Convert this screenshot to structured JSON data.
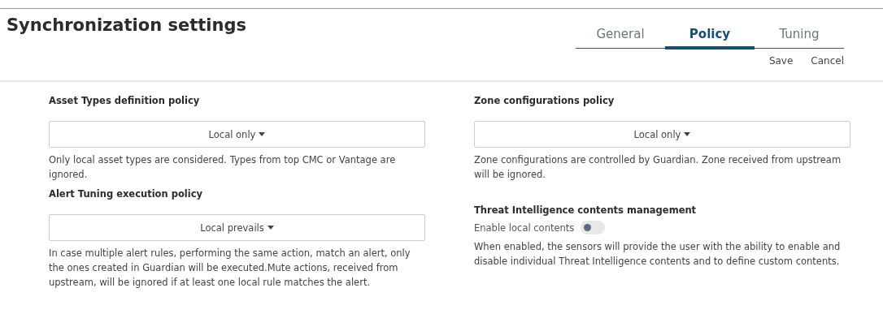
{
  "title": "Synchronization settings",
  "tabs": [
    {
      "label": "General",
      "selected": false
    },
    {
      "label": "Policy",
      "selected": true
    },
    {
      "label": "Tuning",
      "selected": false
    }
  ],
  "actions": [
    "Save",
    "Cancel"
  ],
  "columns": [
    {
      "sections": [
        {
          "kind": "select",
          "heading": "Asset Types definition policy",
          "value": "Local only",
          "description": "Only local asset types are considered. Types from top CMC or Vantage are ignored."
        },
        {
          "kind": "select",
          "heading": "Alert Tuning execution policy",
          "value": "Local prevails",
          "description": "In case multiple alert rules, performing the same action, match an alert, only the ones created in Guardian will be executed.Mute actions, received from upstream, will be ignored if at least one local rule matches the alert."
        }
      ]
    },
    {
      "sections": [
        {
          "kind": "select",
          "heading": "Zone configurations policy",
          "value": "Local only",
          "description": "Zone configurations are controlled by Guardian. Zone received from upstream will be ignored."
        },
        {
          "kind": "toggle",
          "heading": "Threat Intelligence contents management",
          "label": "Enable local contents",
          "on": false,
          "description": "When enabled, the sensors will provide the user with the ability to enable and disable individual Threat Intelligence contents and to define custom contents."
        }
      ]
    }
  ]
}
